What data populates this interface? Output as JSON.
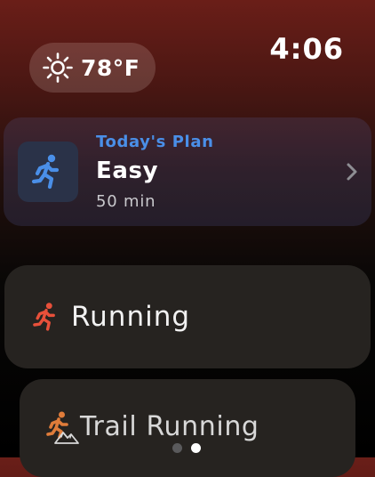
{
  "status": {
    "weather_temp": "78°F",
    "weather_icon": "sun-icon",
    "time": "4:06"
  },
  "plan": {
    "kicker": "Today's Plan",
    "title": "Easy",
    "duration": "50 min",
    "icon": "runner-icon",
    "accent_color": "#4a8fe8"
  },
  "workouts": [
    {
      "label": "Running",
      "icon": "runner-icon",
      "icon_color": "#e8503a"
    },
    {
      "label": "Trail Running",
      "icon": "trail-runner-icon",
      "icon_color": "#e07c3a"
    }
  ],
  "pagination": {
    "current_page": 2,
    "page_count": 2
  }
}
